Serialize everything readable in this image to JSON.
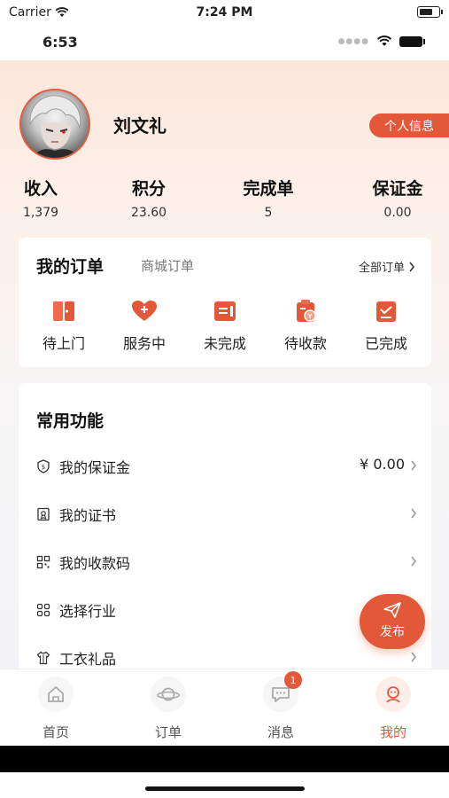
{
  "system_status": {
    "carrier": "Carrier",
    "time": "7:24 PM"
  },
  "app_status": {
    "time": "6:53"
  },
  "profile": {
    "name": "刘文礼",
    "info_button": "个人信息"
  },
  "stats": [
    {
      "label": "收入",
      "value": "1,379"
    },
    {
      "label": "积分",
      "value": "23.60"
    },
    {
      "label": "完成单",
      "value": "5"
    },
    {
      "label": "保证金",
      "value": "0.00"
    }
  ],
  "orders": {
    "title": "我的订单",
    "tab": "商城订单",
    "all": "全部订单",
    "items": [
      {
        "label": "待上门",
        "icon": "door-icon"
      },
      {
        "label": "服务中",
        "icon": "heart-plus-icon"
      },
      {
        "label": "未完成",
        "icon": "note-icon"
      },
      {
        "label": "待收款",
        "icon": "payment-icon"
      },
      {
        "label": "已完成",
        "icon": "clipboard-check-icon"
      }
    ]
  },
  "features": {
    "title": "常用功能",
    "items": [
      {
        "label": "我的保证金",
        "value": "¥ 0.00",
        "icon": "shield-icon"
      },
      {
        "label": "我的证书",
        "value": "",
        "icon": "certificate-icon"
      },
      {
        "label": "我的收款码",
        "value": "",
        "icon": "qr-code-icon"
      },
      {
        "label": "选择行业",
        "value": "",
        "icon": "grid-icon"
      },
      {
        "label": "工衣礼品",
        "value": "",
        "icon": "shirt-icon"
      }
    ]
  },
  "fab": {
    "label": "发布"
  },
  "tabs": [
    {
      "label": "首页",
      "icon": "home-icon"
    },
    {
      "label": "订单",
      "icon": "planet-icon"
    },
    {
      "label": "消息",
      "icon": "message-icon",
      "badge": "1"
    },
    {
      "label": "我的",
      "icon": "profile-icon",
      "active": true
    }
  ],
  "colors": {
    "accent": "#e4583a",
    "background_top": "#fbe4d6"
  }
}
